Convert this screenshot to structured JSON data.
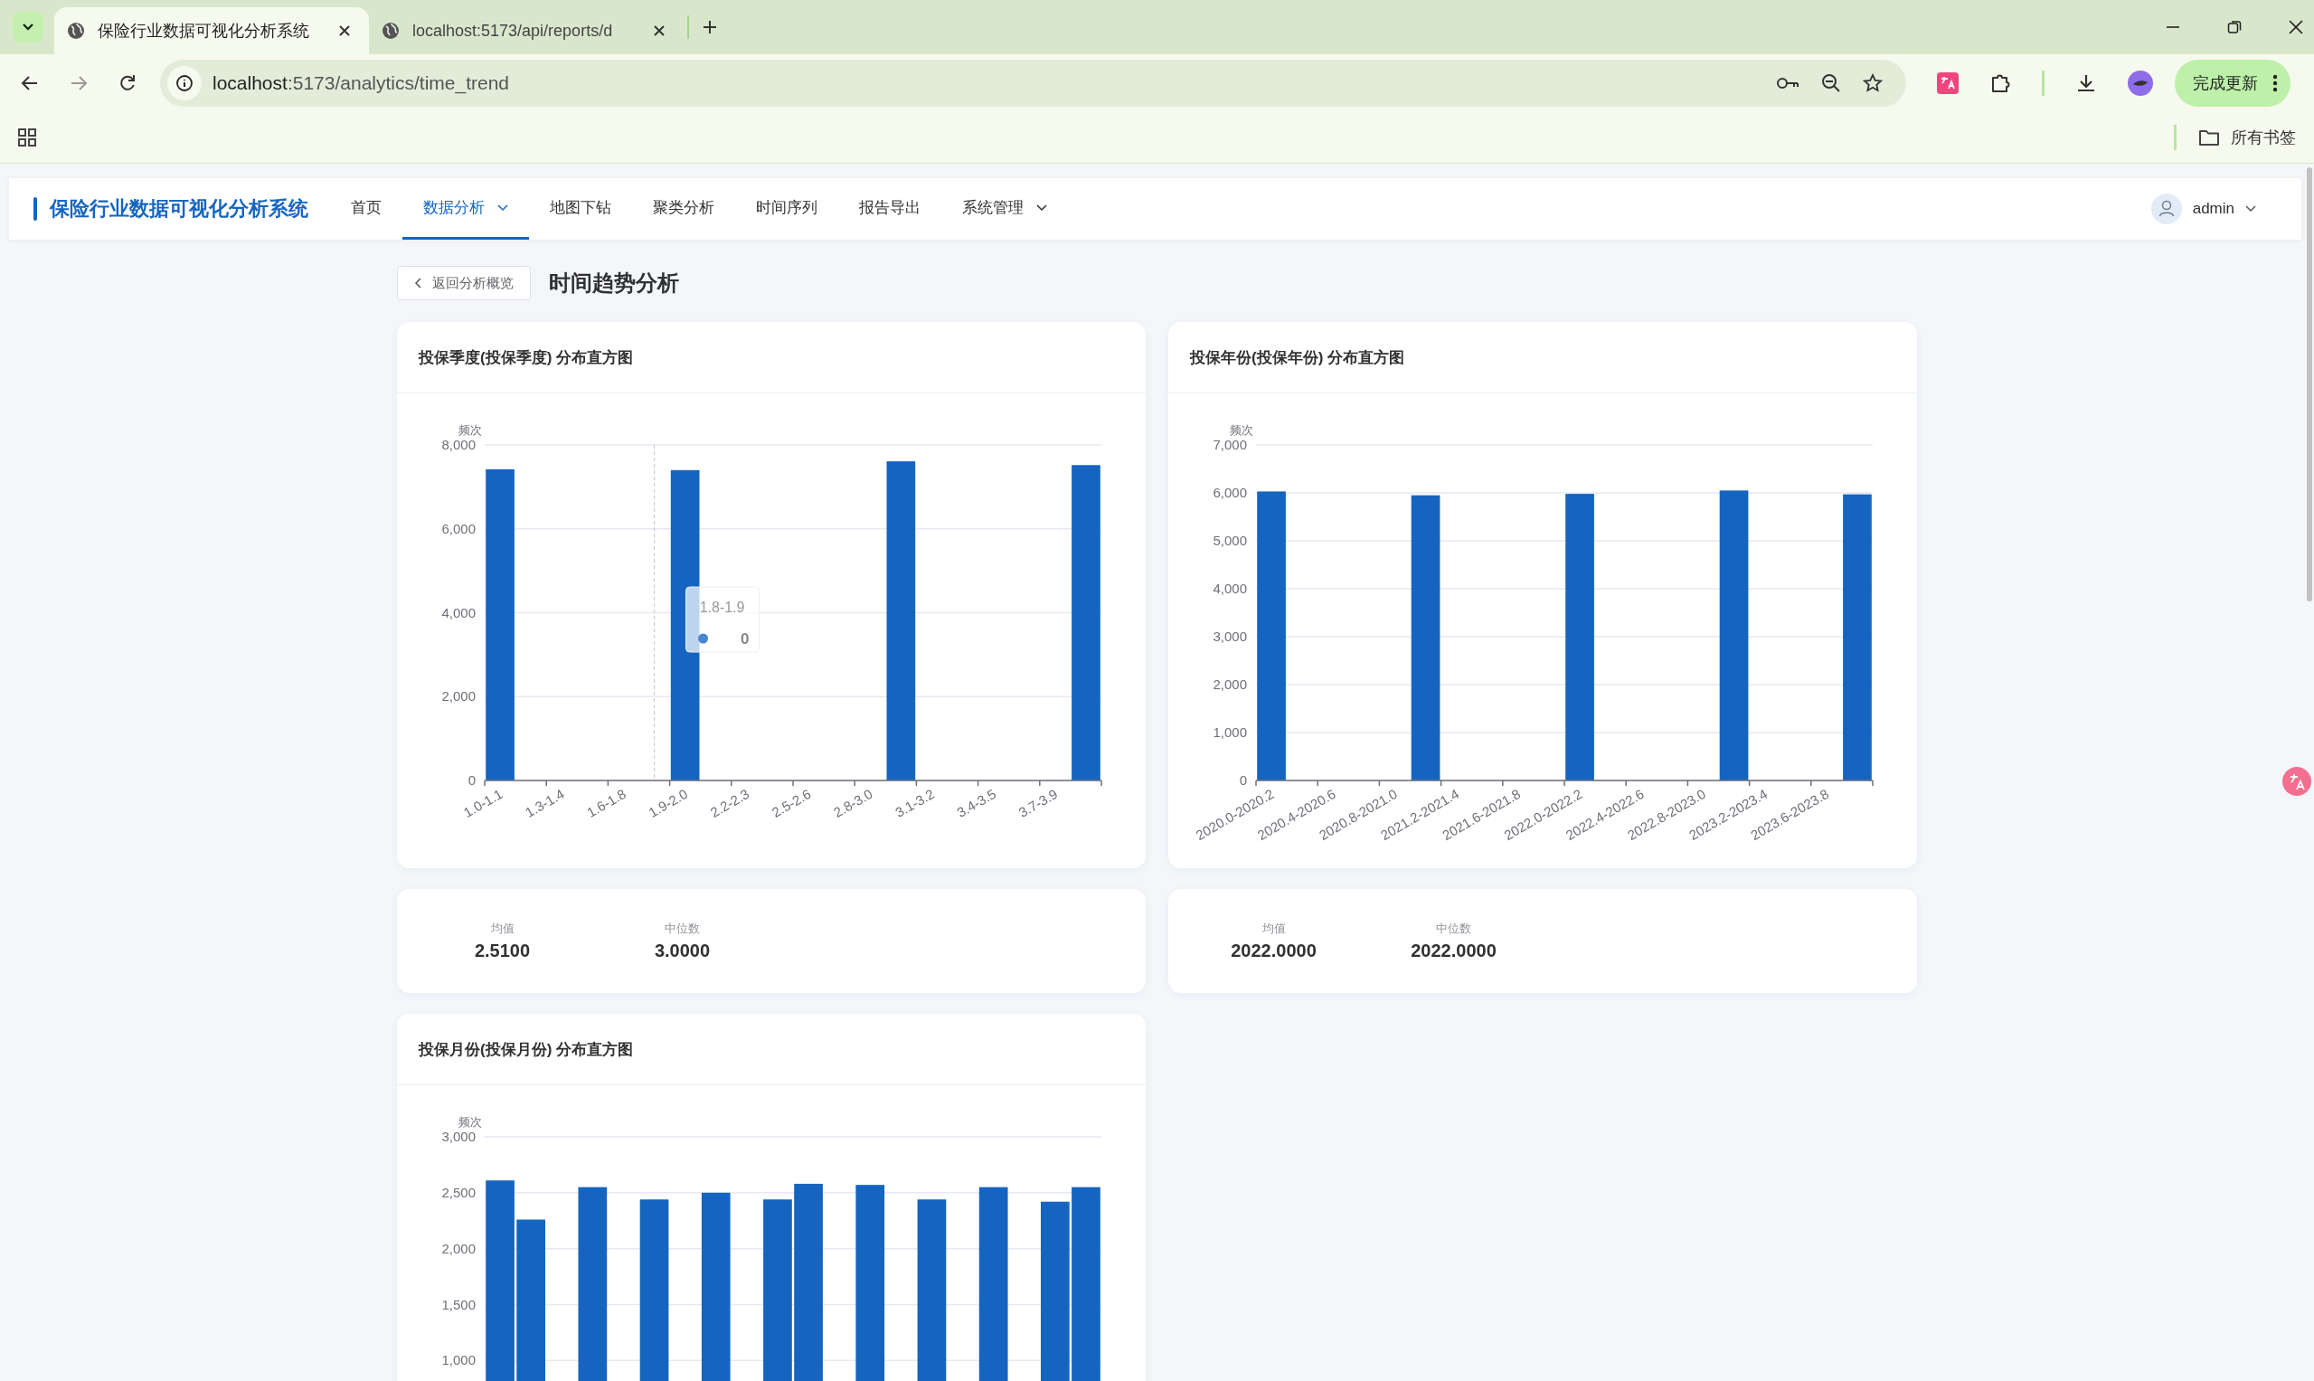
{
  "browser": {
    "tabs": [
      {
        "title": "保险行业数据可视化分析系统",
        "selected": true
      },
      {
        "title": "localhost:5173/api/reports/d",
        "selected": false
      }
    ],
    "address_host": "localhost",
    "address_rest": ":5173/analytics/time_trend",
    "update_button": "完成更新",
    "bookmarks_folder": "所有书签"
  },
  "app": {
    "brand": "保险行业数据可视化分析系统",
    "nav": [
      {
        "label": "首页",
        "selected": false,
        "dropdown": false
      },
      {
        "label": "数据分析",
        "selected": true,
        "dropdown": true
      },
      {
        "label": "地图下钻",
        "selected": false,
        "dropdown": false
      },
      {
        "label": "聚类分析",
        "selected": false,
        "dropdown": false
      },
      {
        "label": "时间序列",
        "selected": false,
        "dropdown": false
      },
      {
        "label": "报告导出",
        "selected": false,
        "dropdown": false
      },
      {
        "label": "系统管理",
        "selected": false,
        "dropdown": true
      }
    ],
    "user": "admin"
  },
  "page": {
    "back_button": "返回分析概览",
    "title": "时间趋势分析"
  },
  "histograms": [
    {
      "title": "投保季度(投保季度) 分布直方图",
      "tooltip": {
        "title": "1.8-1.9",
        "value": "0"
      },
      "chart_data": {
        "type": "bar",
        "grid": true,
        "ylabel": "频次",
        "ylim": [
          0,
          8000
        ],
        "yticks": [
          {
            "value": 0,
            "label": "0"
          },
          {
            "value": 2000,
            "label": "2,000"
          },
          {
            "value": 4000,
            "label": "4,000"
          },
          {
            "value": 6000,
            "label": "6,000"
          },
          {
            "value": 8000,
            "label": "8,000"
          }
        ],
        "values": [
          7420,
          0,
          0,
          0,
          0,
          0,
          7400,
          0,
          0,
          0,
          0,
          0,
          0,
          7610,
          0,
          0,
          0,
          0,
          0,
          7520
        ],
        "categories": [
          "1.0-1.1",
          null,
          "1.3-1.4",
          null,
          "1.6-1.8",
          null,
          "1.9-2.0",
          null,
          "2.2-2.3",
          null,
          "2.5-2.6",
          null,
          "2.8-3.0",
          null,
          "3.1-3.2",
          null,
          "3.4-3.5",
          null,
          "3.7-3.9",
          null
        ]
      },
      "stats": [
        {
          "label": "均值",
          "value": "2.5100"
        },
        {
          "label": "中位数",
          "value": "3.0000"
        }
      ]
    },
    {
      "title": "投保年份(投保年份) 分布直方图",
      "chart_data": {
        "type": "bar",
        "grid": true,
        "ylabel": "频次",
        "ylim": [
          0,
          7000
        ],
        "yticks": [
          {
            "value": 0,
            "label": "0"
          },
          {
            "value": 1000,
            "label": "1,000"
          },
          {
            "value": 2000,
            "label": "2,000"
          },
          {
            "value": 3000,
            "label": "3,000"
          },
          {
            "value": 4000,
            "label": "4,000"
          },
          {
            "value": 5000,
            "label": "5,000"
          },
          {
            "value": 6000,
            "label": "6,000"
          },
          {
            "value": 7000,
            "label": "7,000"
          }
        ],
        "values": [
          6030,
          0,
          0,
          0,
          0,
          5950,
          0,
          0,
          0,
          0,
          5980,
          0,
          0,
          0,
          0,
          6050,
          0,
          0,
          0,
          5970
        ],
        "categories": [
          "2020.0-2020.2",
          null,
          "2020.4-2020.6",
          null,
          "2020.8-2021.0",
          null,
          "2021.2-2021.4",
          null,
          "2021.6-2021.8",
          null,
          "2022.0-2022.2",
          null,
          "2022.4-2022.6",
          null,
          "2022.8-2023.0",
          null,
          "2023.2-2023.4",
          null,
          "2023.6-2023.8",
          null
        ]
      },
      "stats": [
        {
          "label": "均值",
          "value": "2022.0000"
        },
        {
          "label": "中位数",
          "value": "2022.0000"
        }
      ]
    },
    {
      "title": "投保月份(投保月份) 分布直方图",
      "chart_data": {
        "type": "bar",
        "grid": true,
        "ylabel": "频次",
        "ylim": [
          0,
          3000
        ],
        "yticks": [
          {
            "value": 1000,
            "label": "1,000"
          },
          {
            "value": 1500,
            "label": "1,500"
          },
          {
            "value": 2000,
            "label": "2,000"
          },
          {
            "value": 2500,
            "label": "2,500"
          },
          {
            "value": 3000,
            "label": "3,000"
          }
        ],
        "values": [
          2610,
          2260,
          0,
          2550,
          0,
          2440,
          0,
          2500,
          0,
          2440,
          2580,
          0,
          2570,
          0,
          2440,
          0,
          2550,
          0,
          2420,
          2550
        ]
      }
    }
  ]
}
